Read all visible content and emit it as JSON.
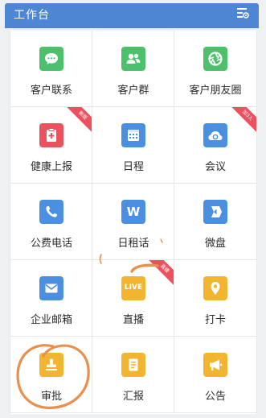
{
  "header": {
    "title": "工作台",
    "settings_icon": "list-settings-icon"
  },
  "colors": {
    "header": "#4f86d4",
    "green": "#4cc06a",
    "red": "#ea5260",
    "blue": "#4a8fe0",
    "yellow": "#f2b530",
    "annotation": "#e8904c"
  },
  "apps": [
    {
      "label": "客户联系",
      "icon": "chat-bubble-icon"
    },
    {
      "label": "客户群",
      "icon": "group-icon"
    },
    {
      "label": "客户朋友圈",
      "icon": "aperture-icon"
    },
    {
      "label": "健康上报",
      "icon": "clipboard-plus-icon",
      "badge": "新版"
    },
    {
      "label": "日程",
      "icon": "calendar-icon"
    },
    {
      "label": "会议",
      "icon": "cloud-meeting-icon",
      "badge": "加3人"
    },
    {
      "label": "公费电话",
      "icon": "phone-icon"
    },
    {
      "label": "日租话",
      "icon": "w-letter-icon"
    },
    {
      "label": "微盘",
      "icon": "drive-icon"
    },
    {
      "label": "企业邮箱",
      "icon": "mail-icon"
    },
    {
      "label": "直播",
      "icon": "live-icon",
      "icon_text": "LIVE",
      "badge": "直播"
    },
    {
      "label": "打卡",
      "icon": "location-pin-icon"
    },
    {
      "label": "审批",
      "icon": "stamp-icon"
    },
    {
      "label": "汇报",
      "icon": "report-doc-icon"
    },
    {
      "label": "公告",
      "icon": "megaphone-icon"
    }
  ]
}
